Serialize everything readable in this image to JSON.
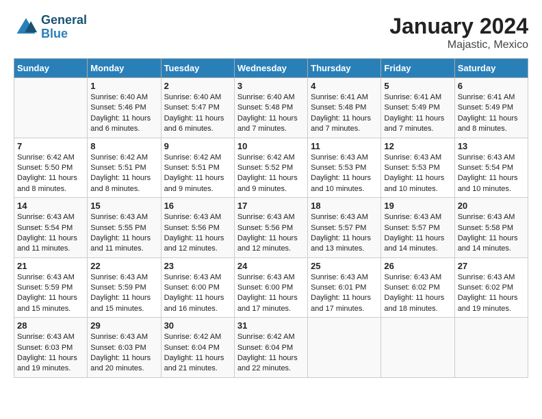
{
  "header": {
    "logo_line1": "General",
    "logo_line2": "Blue",
    "main_title": "January 2024",
    "subtitle": "Majastic, Mexico"
  },
  "columns": [
    "Sunday",
    "Monday",
    "Tuesday",
    "Wednesday",
    "Thursday",
    "Friday",
    "Saturday"
  ],
  "weeks": [
    [
      {
        "day": "",
        "sunrise": "",
        "sunset": "",
        "daylight": ""
      },
      {
        "day": "1",
        "sunrise": "Sunrise: 6:40 AM",
        "sunset": "Sunset: 5:46 PM",
        "daylight": "Daylight: 11 hours and 6 minutes."
      },
      {
        "day": "2",
        "sunrise": "Sunrise: 6:40 AM",
        "sunset": "Sunset: 5:47 PM",
        "daylight": "Daylight: 11 hours and 6 minutes."
      },
      {
        "day": "3",
        "sunrise": "Sunrise: 6:40 AM",
        "sunset": "Sunset: 5:48 PM",
        "daylight": "Daylight: 11 hours and 7 minutes."
      },
      {
        "day": "4",
        "sunrise": "Sunrise: 6:41 AM",
        "sunset": "Sunset: 5:48 PM",
        "daylight": "Daylight: 11 hours and 7 minutes."
      },
      {
        "day": "5",
        "sunrise": "Sunrise: 6:41 AM",
        "sunset": "Sunset: 5:49 PM",
        "daylight": "Daylight: 11 hours and 7 minutes."
      },
      {
        "day": "6",
        "sunrise": "Sunrise: 6:41 AM",
        "sunset": "Sunset: 5:49 PM",
        "daylight": "Daylight: 11 hours and 8 minutes."
      }
    ],
    [
      {
        "day": "7",
        "sunrise": "Sunrise: 6:42 AM",
        "sunset": "Sunset: 5:50 PM",
        "daylight": "Daylight: 11 hours and 8 minutes."
      },
      {
        "day": "8",
        "sunrise": "Sunrise: 6:42 AM",
        "sunset": "Sunset: 5:51 PM",
        "daylight": "Daylight: 11 hours and 8 minutes."
      },
      {
        "day": "9",
        "sunrise": "Sunrise: 6:42 AM",
        "sunset": "Sunset: 5:51 PM",
        "daylight": "Daylight: 11 hours and 9 minutes."
      },
      {
        "day": "10",
        "sunrise": "Sunrise: 6:42 AM",
        "sunset": "Sunset: 5:52 PM",
        "daylight": "Daylight: 11 hours and 9 minutes."
      },
      {
        "day": "11",
        "sunrise": "Sunrise: 6:43 AM",
        "sunset": "Sunset: 5:53 PM",
        "daylight": "Daylight: 11 hours and 10 minutes."
      },
      {
        "day": "12",
        "sunrise": "Sunrise: 6:43 AM",
        "sunset": "Sunset: 5:53 PM",
        "daylight": "Daylight: 11 hours and 10 minutes."
      },
      {
        "day": "13",
        "sunrise": "Sunrise: 6:43 AM",
        "sunset": "Sunset: 5:54 PM",
        "daylight": "Daylight: 11 hours and 10 minutes."
      }
    ],
    [
      {
        "day": "14",
        "sunrise": "Sunrise: 6:43 AM",
        "sunset": "Sunset: 5:54 PM",
        "daylight": "Daylight: 11 hours and 11 minutes."
      },
      {
        "day": "15",
        "sunrise": "Sunrise: 6:43 AM",
        "sunset": "Sunset: 5:55 PM",
        "daylight": "Daylight: 11 hours and 11 minutes."
      },
      {
        "day": "16",
        "sunrise": "Sunrise: 6:43 AM",
        "sunset": "Sunset: 5:56 PM",
        "daylight": "Daylight: 11 hours and 12 minutes."
      },
      {
        "day": "17",
        "sunrise": "Sunrise: 6:43 AM",
        "sunset": "Sunset: 5:56 PM",
        "daylight": "Daylight: 11 hours and 12 minutes."
      },
      {
        "day": "18",
        "sunrise": "Sunrise: 6:43 AM",
        "sunset": "Sunset: 5:57 PM",
        "daylight": "Daylight: 11 hours and 13 minutes."
      },
      {
        "day": "19",
        "sunrise": "Sunrise: 6:43 AM",
        "sunset": "Sunset: 5:57 PM",
        "daylight": "Daylight: 11 hours and 14 minutes."
      },
      {
        "day": "20",
        "sunrise": "Sunrise: 6:43 AM",
        "sunset": "Sunset: 5:58 PM",
        "daylight": "Daylight: 11 hours and 14 minutes."
      }
    ],
    [
      {
        "day": "21",
        "sunrise": "Sunrise: 6:43 AM",
        "sunset": "Sunset: 5:59 PM",
        "daylight": "Daylight: 11 hours and 15 minutes."
      },
      {
        "day": "22",
        "sunrise": "Sunrise: 6:43 AM",
        "sunset": "Sunset: 5:59 PM",
        "daylight": "Daylight: 11 hours and 15 minutes."
      },
      {
        "day": "23",
        "sunrise": "Sunrise: 6:43 AM",
        "sunset": "Sunset: 6:00 PM",
        "daylight": "Daylight: 11 hours and 16 minutes."
      },
      {
        "day": "24",
        "sunrise": "Sunrise: 6:43 AM",
        "sunset": "Sunset: 6:00 PM",
        "daylight": "Daylight: 11 hours and 17 minutes."
      },
      {
        "day": "25",
        "sunrise": "Sunrise: 6:43 AM",
        "sunset": "Sunset: 6:01 PM",
        "daylight": "Daylight: 11 hours and 17 minutes."
      },
      {
        "day": "26",
        "sunrise": "Sunrise: 6:43 AM",
        "sunset": "Sunset: 6:02 PM",
        "daylight": "Daylight: 11 hours and 18 minutes."
      },
      {
        "day": "27",
        "sunrise": "Sunrise: 6:43 AM",
        "sunset": "Sunset: 6:02 PM",
        "daylight": "Daylight: 11 hours and 19 minutes."
      }
    ],
    [
      {
        "day": "28",
        "sunrise": "Sunrise: 6:43 AM",
        "sunset": "Sunset: 6:03 PM",
        "daylight": "Daylight: 11 hours and 19 minutes."
      },
      {
        "day": "29",
        "sunrise": "Sunrise: 6:43 AM",
        "sunset": "Sunset: 6:03 PM",
        "daylight": "Daylight: 11 hours and 20 minutes."
      },
      {
        "day": "30",
        "sunrise": "Sunrise: 6:42 AM",
        "sunset": "Sunset: 6:04 PM",
        "daylight": "Daylight: 11 hours and 21 minutes."
      },
      {
        "day": "31",
        "sunrise": "Sunrise: 6:42 AM",
        "sunset": "Sunset: 6:04 PM",
        "daylight": "Daylight: 11 hours and 22 minutes."
      },
      {
        "day": "",
        "sunrise": "",
        "sunset": "",
        "daylight": ""
      },
      {
        "day": "",
        "sunrise": "",
        "sunset": "",
        "daylight": ""
      },
      {
        "day": "",
        "sunrise": "",
        "sunset": "",
        "daylight": ""
      }
    ]
  ]
}
